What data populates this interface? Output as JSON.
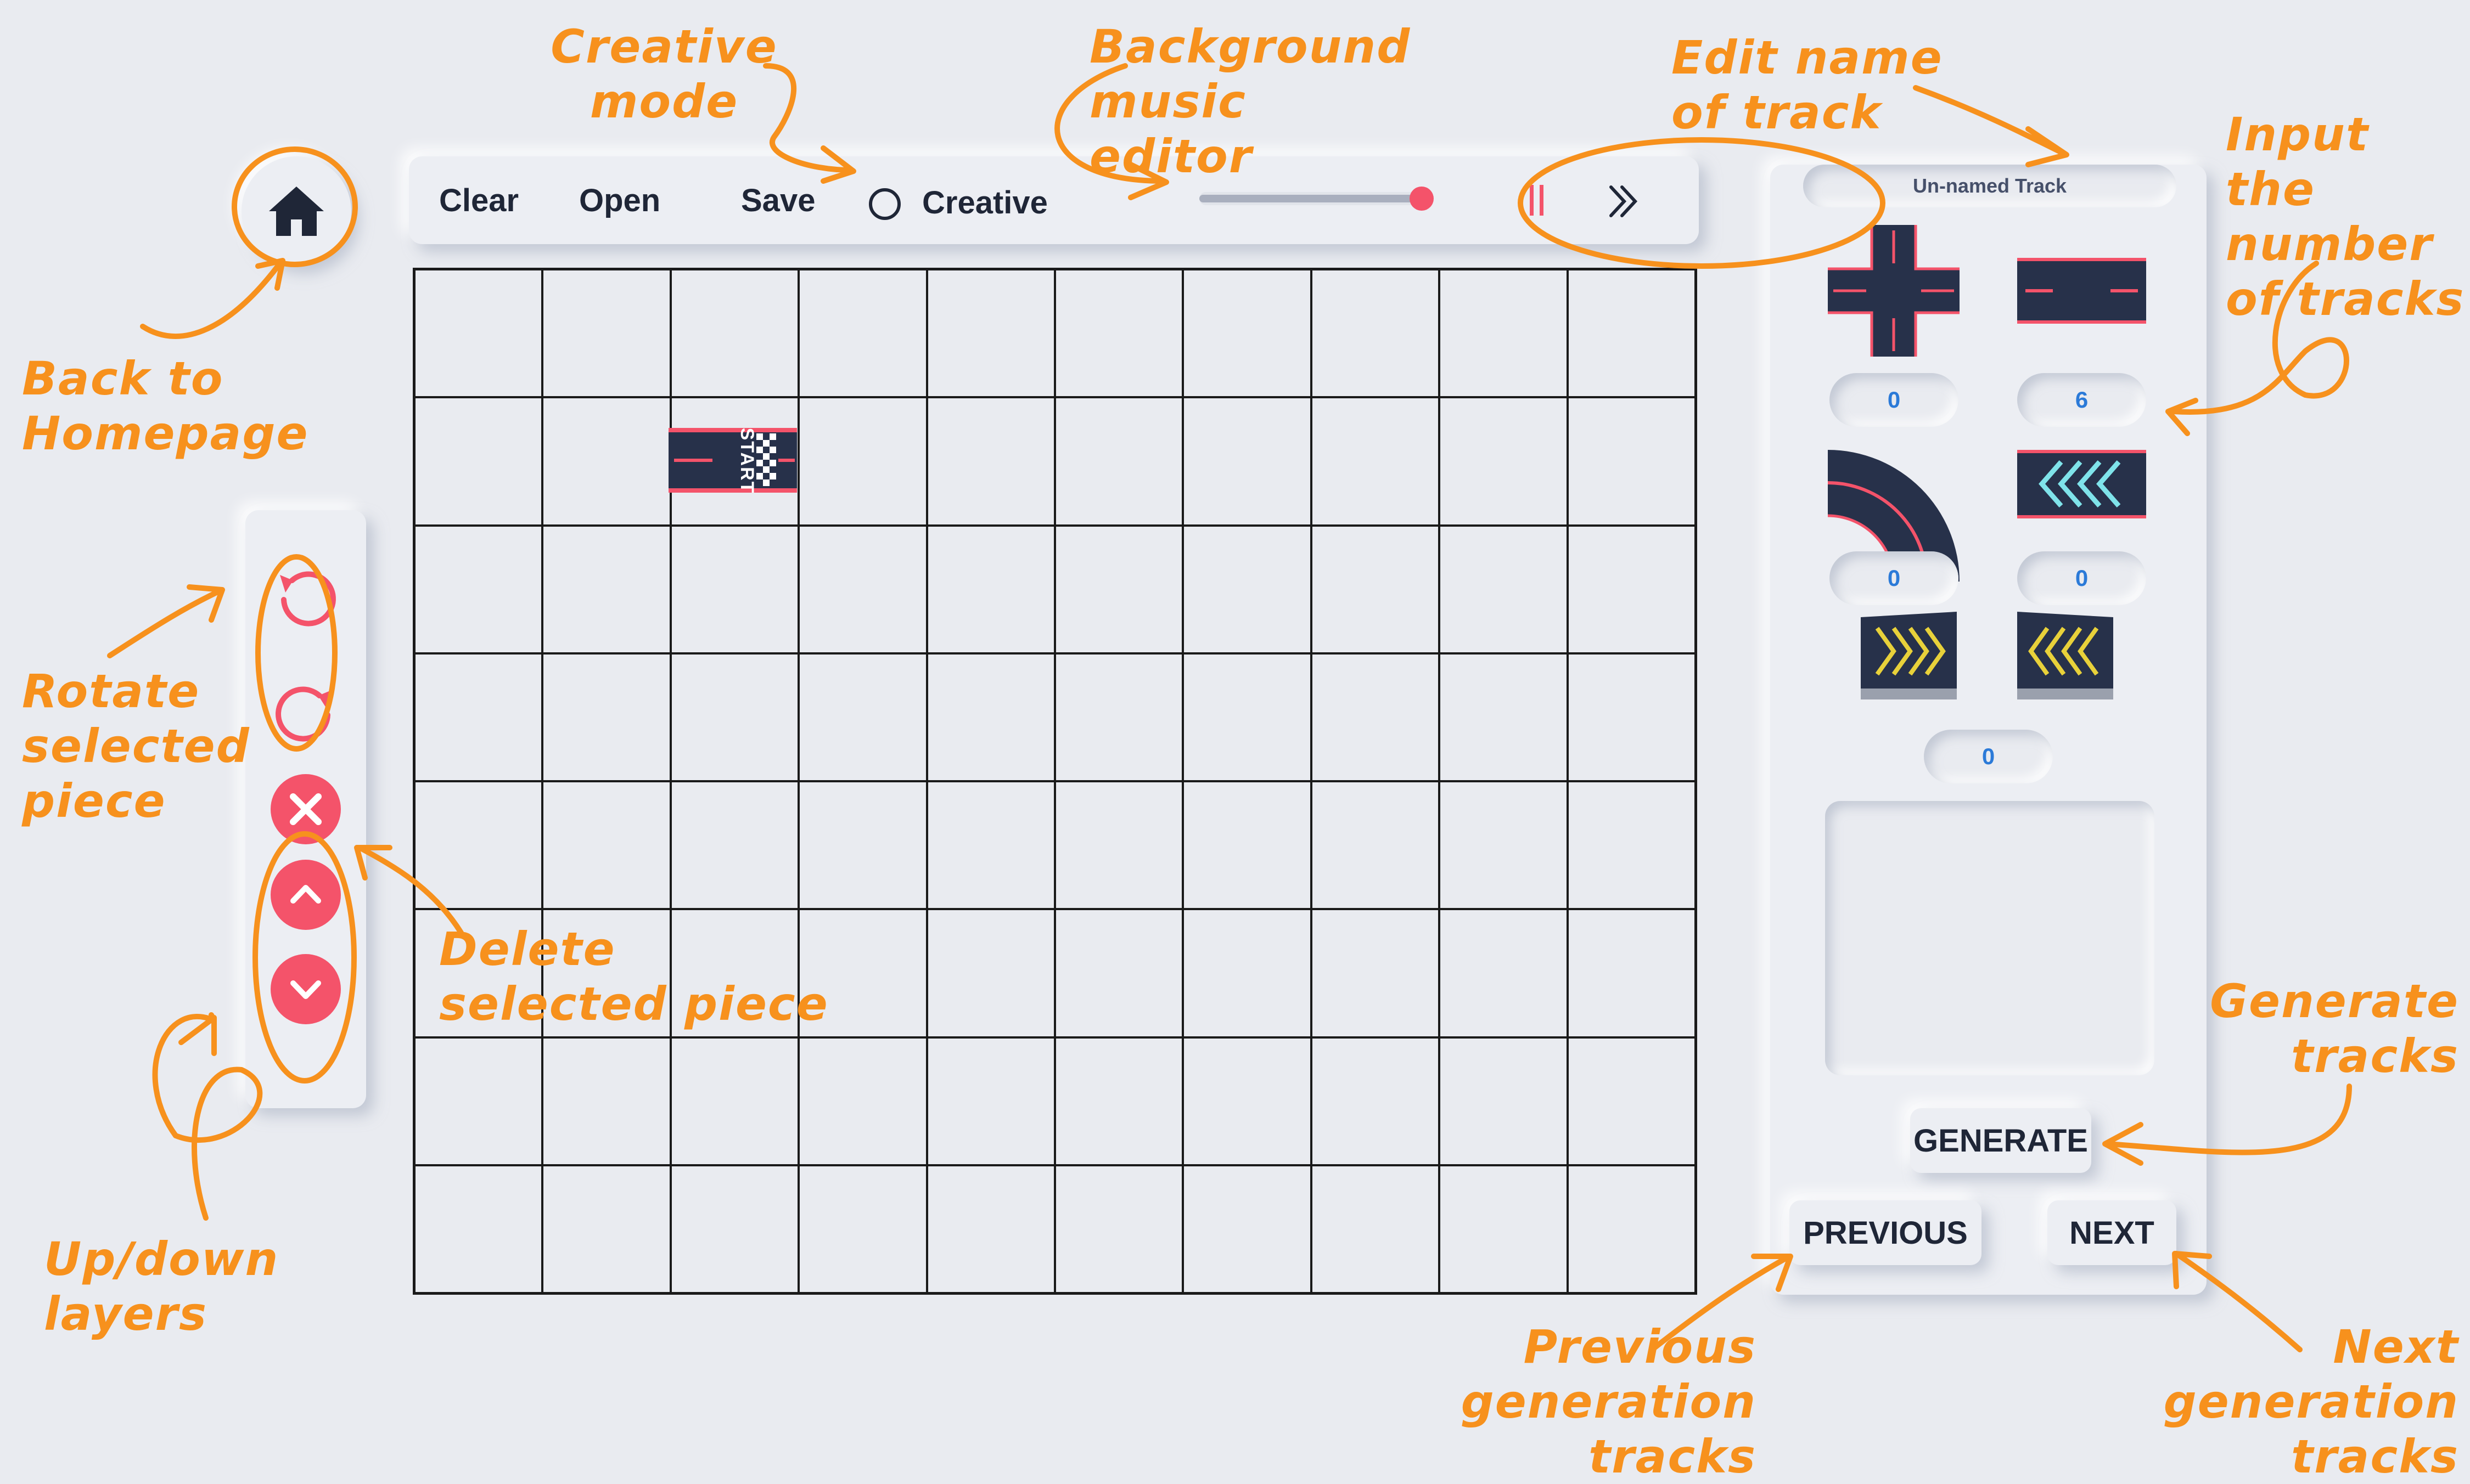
{
  "toolbar": {
    "clear_label": "Clear",
    "open_label": "Open",
    "save_label": "Save",
    "creative_label": "Creative",
    "music_volume": 0.9
  },
  "grid": {
    "columns": 10,
    "rows": 8,
    "start_piece": {
      "column": 3,
      "row": 2,
      "label": "START"
    }
  },
  "panel": {
    "track_name": "Un-named Track",
    "counts": {
      "crossroad": "0",
      "straight": "6",
      "curve": "0",
      "boost": "0",
      "ramp": "0"
    },
    "generate_label": "GENERATE",
    "previous_label": "PREVIOUS",
    "next_label": "NEXT"
  },
  "annotations": {
    "creative_mode": "Creative\nmode",
    "music_editor": "Background music\neditor",
    "edit_name": "Edit name\nof track",
    "input_number": "Input the\nnumber\nof tracks",
    "back_home": "Back to\nHomepage",
    "rotate": "Rotate\nselected\npiece",
    "delete": "Delete\nselected piece",
    "updown": "Up/down\nlayers",
    "generate": "Generate\ntracks",
    "previous": "Previous\ngeneration tracks",
    "next": "Next\ngeneration tracks"
  },
  "colors": {
    "background": "#e9ebf0",
    "accent_red": "#f4536a",
    "annotation_orange": "#f7911d",
    "road_dark": "#27314a",
    "count_blue": "#2b7ad8"
  },
  "icons": [
    "home-icon",
    "rotate-ccw-icon",
    "rotate-cw-icon",
    "close-icon",
    "chevron-up-icon",
    "chevron-down-icon",
    "pause-icon",
    "skip-forward-icon"
  ]
}
